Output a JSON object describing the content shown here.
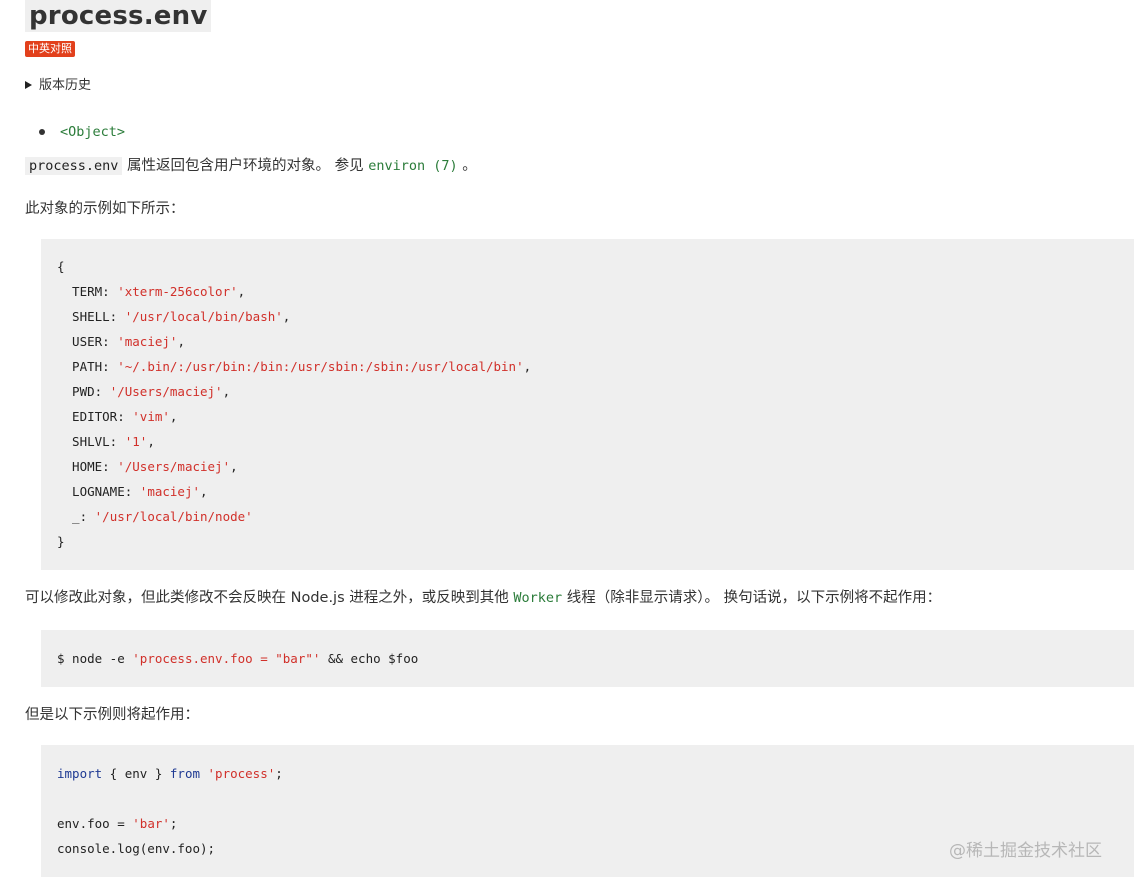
{
  "heading": {
    "title": "process.env",
    "badge": "中英对照"
  },
  "history_toggle": {
    "label": "版本历史"
  },
  "type_item": "<Object>",
  "para1": {
    "code": "process.env",
    "text1": " 属性返回包含用户环境的对象。 参见 ",
    "link": "environ (7)",
    "text2": " 。"
  },
  "para2": "此对象的示例如下所示：",
  "code1": {
    "open": "{",
    "entries": [
      {
        "key": "  TERM: ",
        "val": "'xterm-256color'",
        "end": ","
      },
      {
        "key": "  SHELL: ",
        "val": "'/usr/local/bin/bash'",
        "end": ","
      },
      {
        "key": "  USER: ",
        "val": "'maciej'",
        "end": ","
      },
      {
        "key": "  PATH: ",
        "val": "'~/.bin/:/usr/bin:/bin:/usr/sbin:/sbin:/usr/local/bin'",
        "end": ","
      },
      {
        "key": "  PWD: ",
        "val": "'/Users/maciej'",
        "end": ","
      },
      {
        "key": "  EDITOR: ",
        "val": "'vim'",
        "end": ","
      },
      {
        "key": "  SHLVL: ",
        "val": "'1'",
        "end": ","
      },
      {
        "key": "  HOME: ",
        "val": "'/Users/maciej'",
        "end": ","
      },
      {
        "key": "  LOGNAME: ",
        "val": "'maciej'",
        "end": ","
      },
      {
        "key": "  _: ",
        "val": "'/usr/local/bin/node'",
        "end": ""
      }
    ],
    "close": "}"
  },
  "para3": {
    "text1": "可以修改此对象，但此类修改不会反映在 Node.js 进程之外，或反映到其他 ",
    "link": "Worker",
    "text2": " 线程（除非显示请求）。 换句话说，以下示例将不起作用："
  },
  "code2": {
    "prefix": "$ node -e ",
    "str": "'process.env.foo = \"bar\"'",
    "suffix": " && echo $foo"
  },
  "para4": "但是以下示例则将起作用：",
  "code3": {
    "import_kw": "import",
    "import_mid": " { env } ",
    "from_kw": "from",
    "import_space": " ",
    "import_str": "'process'",
    "import_end": ";",
    "assign_pre": "env.foo = ",
    "assign_str": "'bar'",
    "assign_end": ";",
    "log_line": "console.log(env.foo);"
  },
  "watermark": "@稀土掘金技术社区"
}
